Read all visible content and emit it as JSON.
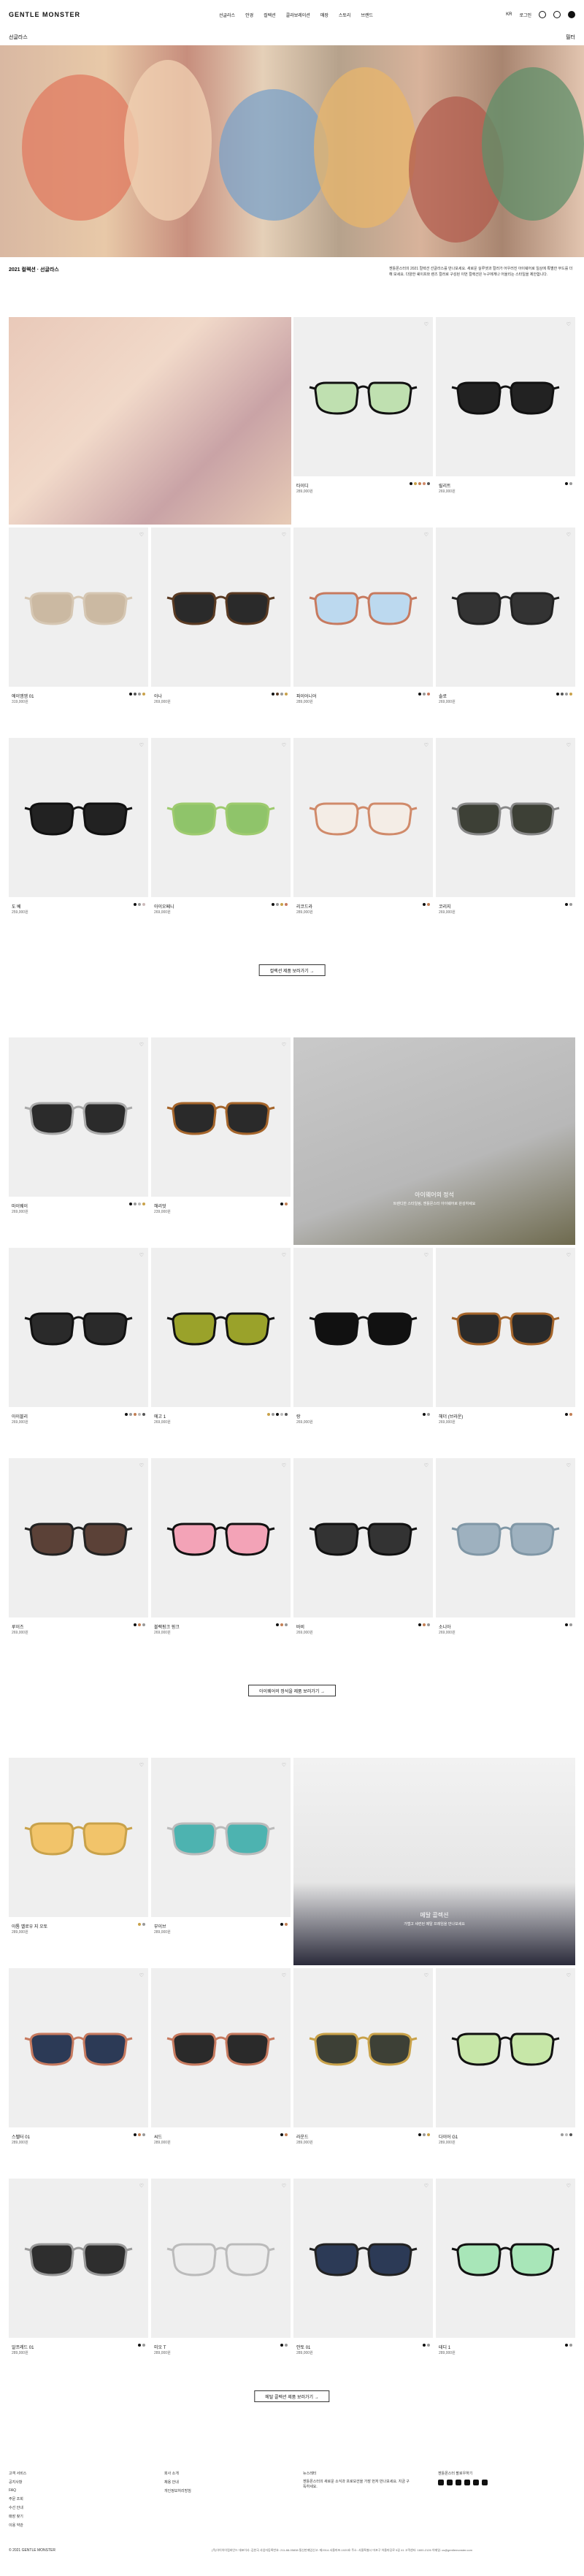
{
  "header": {
    "logo": "GENTLE MONSTER",
    "nav": [
      "선글라스",
      "안경",
      "컬렉션",
      "콜라보레이션",
      "매장",
      "스토리",
      "브랜드"
    ],
    "util": [
      "KR",
      "로그인"
    ]
  },
  "subbar": {
    "title": "선글라스",
    "filter": "필터"
  },
  "intro": {
    "heading": "2021 컬렉션 · 선글라스",
    "body": "젠틀몬스터의 2021 컬렉션 선글라스를 만나보세요. 새로운 실루엣과 컬러가 어우러진 아이웨어로 일상에 특별한 무드를 더해 보세요. 다양한 쉐이프와 렌즈 컬러로 구성된 이번 컬렉션은 누구에게나 어울리는 스타일을 제안합니다."
  },
  "section1": {
    "products": [
      {
        "name": "타이디",
        "price": "289,000원",
        "lens": "#bfe0b0",
        "frame": "#111",
        "swatches": [
          "#111",
          "#c9a24a",
          "#c27f54",
          "#d08a6a",
          "#555"
        ]
      },
      {
        "name": "릴리트",
        "price": "269,000원",
        "lens": "#222",
        "frame": "#111",
        "swatches": [
          "#111",
          "#999"
        ]
      },
      {
        "name": "에이엠엠 01",
        "price": "319,000원",
        "lens": "#cbb9a2",
        "frame": "#d6c7b3",
        "swatches": [
          "#111",
          "#555",
          "#999",
          "#c9a24a"
        ]
      },
      {
        "name": "아나",
        "price": "269,000원",
        "lens": "#2a2a2a",
        "frame": "#5a3a22",
        "swatches": [
          "#111",
          "#5a3a22",
          "#999",
          "#c9a24a"
        ]
      },
      {
        "name": "파이어니어",
        "price": "289,000원",
        "lens": "#bcd9ef",
        "frame": "#c77a5f",
        "swatches": [
          "#111",
          "#999",
          "#c77a5f"
        ]
      },
      {
        "name": "솔로",
        "price": "269,000원",
        "lens": "#333",
        "frame": "#222",
        "swatches": [
          "#111",
          "#555",
          "#999",
          "#c9a24a"
        ]
      },
      {
        "name": "도 베",
        "price": "259,000원",
        "lens": "#222",
        "frame": "#111",
        "swatches": [
          "#111",
          "#999",
          "#cbb"
        ]
      },
      {
        "name": "아이오페니",
        "price": "269,000원",
        "lens": "#8fc46a",
        "frame": "#9ecb6f",
        "swatches": [
          "#111",
          "#999",
          "#c9a24a",
          "#c77a5f"
        ]
      },
      {
        "name": "리코드라",
        "price": "289,000원",
        "lens": "#f4ede6",
        "frame": "#d08a6a",
        "swatches": [
          "#111",
          "#c27f54"
        ]
      },
      {
        "name": "코리지",
        "price": "269,000원",
        "lens": "#3d4036",
        "frame": "#888",
        "swatches": [
          "#111",
          "#999"
        ]
      }
    ],
    "more": "컬렉션 제품 보러가기 →"
  },
  "section2": {
    "feature_title": "아이웨어의 정석",
    "feature_sub": "트렌디한 스타일링, 젠틀몬스터 아이웨어로 완성하세요",
    "products": [
      {
        "name": "마이웨이",
        "price": "269,000원",
        "lens": "#2b2b2b",
        "frame": "#aaa",
        "swatches": [
          "#111",
          "#999",
          "#bbb",
          "#c9a24a"
        ]
      },
      {
        "name": "해리엇",
        "price": "239,000원",
        "lens": "#2a2a2a",
        "frame": "#a5652b",
        "swatches": [
          "#111",
          "#c27f54"
        ]
      },
      {
        "name": "아이블리",
        "price": "269,000원",
        "lens": "#2a2a2a",
        "frame": "#111",
        "swatches": [
          "#111",
          "#999",
          "#c27f54",
          "#bbb",
          "#555"
        ]
      },
      {
        "name": "에고 1",
        "price": "269,000원",
        "lens": "#9aa22a",
        "frame": "#111",
        "swatches": [
          "#c9a24a",
          "#999",
          "#111",
          "#bbb",
          "#555"
        ]
      },
      {
        "name": "랑",
        "price": "269,000원",
        "lens": "#111",
        "frame": "#111",
        "swatches": [
          "#111",
          "#999"
        ]
      },
      {
        "name": "헤더 (브라운)",
        "price": "269,000원",
        "lens": "#2a2a2a",
        "frame": "#a5652b",
        "swatches": [
          "#111",
          "#c27f54"
        ]
      },
      {
        "name": "루이즈",
        "price": "269,000원",
        "lens": "#5b4137",
        "frame": "#222",
        "swatches": [
          "#111",
          "#c27f54",
          "#999"
        ]
      },
      {
        "name": "블랙핑크 핑크",
        "price": "269,000원",
        "lens": "#f3a3b7",
        "frame": "#111",
        "swatches": [
          "#111",
          "#c27f54",
          "#999"
        ]
      },
      {
        "name": "바비",
        "price": "269,000원",
        "lens": "#333",
        "frame": "#111",
        "swatches": [
          "#111",
          "#c27f54",
          "#999"
        ]
      },
      {
        "name": "소니아",
        "price": "269,000원",
        "lens": "#9eb1bf",
        "frame": "#8097a6",
        "swatches": [
          "#111",
          "#999"
        ]
      }
    ],
    "more": "아이웨어의 정석을 제품 보러가기 →"
  },
  "section3": {
    "feature_title": "메탈 콜렉션",
    "feature_sub": "가볍고 세련된 메탈 프레임을 만나보세요",
    "products": [
      {
        "name": "아톰 옐로우 지 오토",
        "price": "289,000원",
        "lens": "#f2c46a",
        "frame": "#c9a24a",
        "swatches": [
          "#c9a24a",
          "#999"
        ]
      },
      {
        "name": "부이브",
        "price": "289,000원",
        "lens": "#4db3b0",
        "frame": "#bbb",
        "swatches": [
          "#111",
          "#c27f54"
        ]
      },
      {
        "name": "스펠터 01",
        "price": "289,000원",
        "lens": "#2c3a56",
        "frame": "#c77a5f",
        "swatches": [
          "#111",
          "#c27f54",
          "#999"
        ]
      },
      {
        "name": "씨드",
        "price": "289,000원",
        "lens": "#2a2a2a",
        "frame": "#c77a5f",
        "swatches": [
          "#111",
          "#c27f54"
        ]
      },
      {
        "name": "라운드",
        "price": "289,000원",
        "lens": "#3d4036",
        "frame": "#c9a24a",
        "swatches": [
          "#111",
          "#999",
          "#c9a24a"
        ]
      },
      {
        "name": "다이어 G1",
        "price": "289,000원",
        "lens": "#c7e7a8",
        "frame": "#111",
        "swatches": [
          "#999",
          "#bbb",
          "#555"
        ]
      },
      {
        "name": "알프레드 01",
        "price": "289,000원",
        "lens": "#2e2e2e",
        "frame": "#999",
        "swatches": [
          "#111",
          "#999"
        ]
      },
      {
        "name": "미오 T",
        "price": "289,000원",
        "lens": "#ededed",
        "frame": "#bbb",
        "swatches": [
          "#111",
          "#999"
        ]
      },
      {
        "name": "안토 01",
        "price": "289,000원",
        "lens": "#2c3a56",
        "frame": "#222",
        "swatches": [
          "#111",
          "#999"
        ]
      },
      {
        "name": "테디 1",
        "price": "289,000원",
        "lens": "#a8e6b8",
        "frame": "#111",
        "swatches": [
          "#111",
          "#999"
        ]
      }
    ],
    "more": "메탈 콜렉션 제품 보러가기 →"
  },
  "footer": {
    "col1": [
      "고객 서비스",
      "공지사항",
      "FAQ",
      "주문 조회",
      "수선 안내",
      "매장 찾기",
      "이용 약관"
    ],
    "col2": [
      "회사 소개",
      "채용 안내",
      "개인정보처리방침"
    ],
    "col3_title": "뉴스레터",
    "col3": "젠틀몬스터의 새로운 소식과 프로모션을 가장 먼저 만나보세요. 지금 구독하세요.",
    "col4_title": "젠틀몬스터 팔로우하기",
    "copyright": "© 2021 GENTLE MONSTER",
    "legal": "(주)아이아이컴바인드 대표이사: 김한국 사업자등록번호: 211-88-05838 통신판매업신고: 제2014-서울마포-1020호 주소: 서울특별시 마포구 어울마당로 5길 41 고객센터: 1600-2126 이메일: cs@gentlemonster.com"
  },
  "colors": {
    "accent": "#111111",
    "bg": "#ffffff",
    "tile": "#efefef"
  },
  "icons": [
    "search-icon",
    "user-icon",
    "bag-icon",
    "heart-icon"
  ]
}
